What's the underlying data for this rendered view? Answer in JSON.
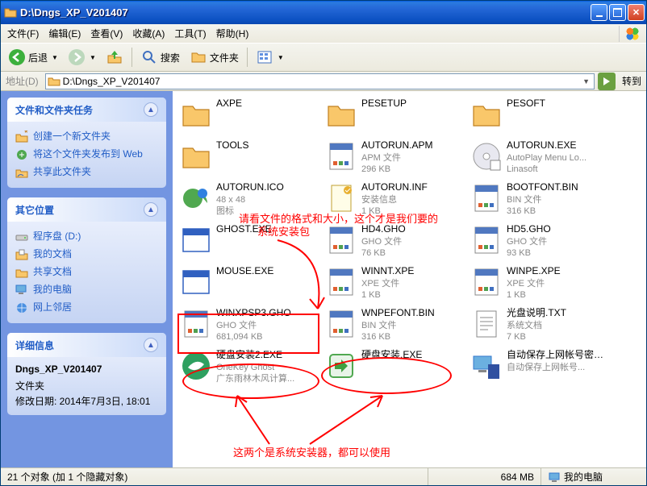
{
  "title": "D:\\Dngs_XP_V201407",
  "menus": [
    "文件(F)",
    "编辑(E)",
    "查看(V)",
    "收藏(A)",
    "工具(T)",
    "帮助(H)"
  ],
  "toolbar": {
    "back": "后退",
    "search": "搜索",
    "folders": "文件夹"
  },
  "address": {
    "label": "地址(D)",
    "path": "D:\\Dngs_XP_V201407",
    "go": "转到"
  },
  "sidebar": {
    "tasks": {
      "title": "文件和文件夹任务",
      "items": [
        {
          "icon": "newfolder",
          "label": "创建一个新文件夹"
        },
        {
          "icon": "publish",
          "label": "将这个文件夹发布到 Web"
        },
        {
          "icon": "share",
          "label": "共享此文件夹"
        }
      ]
    },
    "other": {
      "title": "其它位置",
      "items": [
        {
          "icon": "drive",
          "label": "程序盘 (D:)"
        },
        {
          "icon": "mydocs",
          "label": "我的文档"
        },
        {
          "icon": "sharedocs",
          "label": "共享文档"
        },
        {
          "icon": "computer",
          "label": "我的电脑"
        },
        {
          "icon": "network",
          "label": "网上邻居"
        }
      ]
    },
    "details": {
      "title": "详细信息",
      "name": "Dngs_XP_V201407",
      "type": "文件夹",
      "modified": "修改日期: 2014年7月3日, 18:01"
    }
  },
  "files": [
    {
      "icon": "folder",
      "name": "AXPE",
      "sub1": "",
      "sub2": ""
    },
    {
      "icon": "folder",
      "name": "PESETUP",
      "sub1": "",
      "sub2": ""
    },
    {
      "icon": "folder",
      "name": "PESOFT",
      "sub1": "",
      "sub2": ""
    },
    {
      "icon": "folder",
      "name": "TOOLS",
      "sub1": "",
      "sub2": ""
    },
    {
      "icon": "bin",
      "name": "AUTORUN.APM",
      "sub1": "APM 文件",
      "sub2": "296 KB"
    },
    {
      "icon": "autorun",
      "name": "AUTORUN.EXE",
      "sub1": "AutoPlay Menu Lo...",
      "sub2": "Linasoft"
    },
    {
      "icon": "ico",
      "name": "AUTORUN.ICO",
      "sub1": "48 x 48",
      "sub2": "图标"
    },
    {
      "icon": "inf",
      "name": "AUTORUN.INF",
      "sub1": "安装信息",
      "sub2": "1 KB"
    },
    {
      "icon": "bin",
      "name": "BOOTFONT.BIN",
      "sub1": "BIN 文件",
      "sub2": "316 KB"
    },
    {
      "icon": "exe",
      "name": "GHOST.EXE",
      "sub1": "",
      "sub2": ""
    },
    {
      "icon": "bin",
      "name": "HD4.GHO",
      "sub1": "GHO 文件",
      "sub2": "76 KB"
    },
    {
      "icon": "bin",
      "name": "HD5.GHO",
      "sub1": "GHO 文件",
      "sub2": "93 KB"
    },
    {
      "icon": "exe",
      "name": "MOUSE.EXE",
      "sub1": "",
      "sub2": ""
    },
    {
      "icon": "bin",
      "name": "WINNT.XPE",
      "sub1": "XPE 文件",
      "sub2": "1 KB"
    },
    {
      "icon": "bin",
      "name": "WINPE.XPE",
      "sub1": "XPE 文件",
      "sub2": "1 KB"
    },
    {
      "icon": "bin",
      "name": "WINXPSP3.GHO",
      "sub1": "GHO 文件",
      "sub2": "681,094 KB"
    },
    {
      "icon": "bin",
      "name": "WNPEFONT.BIN",
      "sub1": "BIN 文件",
      "sub2": "316 KB"
    },
    {
      "icon": "txt",
      "name": "光盘说明.TXT",
      "sub1": "系统文档",
      "sub2": "7 KB"
    },
    {
      "icon": "inst1",
      "name": "硬盘安装2.EXE",
      "sub1": "OneKey Ghost",
      "sub2": "广东雨林木风计算..."
    },
    {
      "icon": "inst2",
      "name": "硬盘安装.EXE",
      "sub1": "",
      "sub2": ""
    },
    {
      "icon": "netauto",
      "name": "自动保存上网帐号密码到U盘.EXE",
      "sub1": "自动保存上网帐号...",
      "sub2": ""
    }
  ],
  "annotations": {
    "a1": "请看文件的格式和大小，这个才是我们要的",
    "a1b": "系统安装包",
    "a2": "这两个是系统安装器，都可以使用"
  },
  "status": {
    "left": "21 个对象 (加 1 个隐藏对象)",
    "mid": "684 MB",
    "right": "我的电脑"
  }
}
